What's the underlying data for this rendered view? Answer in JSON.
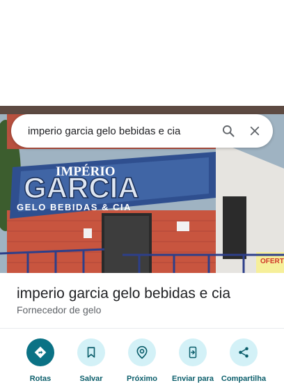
{
  "search": {
    "query": "imperio garcia gelo bebidas e cia"
  },
  "icons": {
    "search": "search-icon",
    "close": "close-icon"
  },
  "photo": {
    "sign_top": "IMPÉRIO",
    "sign_main": "GARCIA",
    "sign_bottom": "GELO BEBIDAS & CIA",
    "poster": "OFERT"
  },
  "place": {
    "title": "imperio garcia gelo bebidas e cia",
    "category": "Fornecedor de gelo"
  },
  "actions": [
    {
      "label": "Rotas",
      "icon": "directions-icon"
    },
    {
      "label": "Salvar",
      "icon": "bookmark-icon"
    },
    {
      "label": "Próximo",
      "icon": "nearby-icon"
    },
    {
      "label": "Enviar para",
      "icon": "send-to-phone-icon"
    },
    {
      "label": "Compartilha",
      "icon": "share-icon"
    }
  ],
  "colors": {
    "primary": "#0b7285",
    "action_bg": "#d3f1f7",
    "label": "#0b5e6b"
  }
}
